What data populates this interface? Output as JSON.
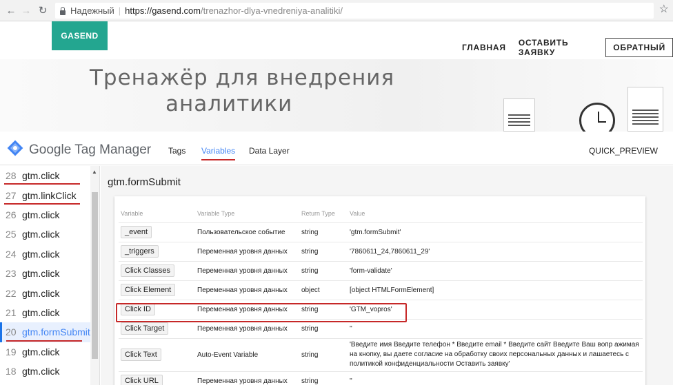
{
  "browser": {
    "secure_label": "Надежный",
    "url_host": "https://gasend.com",
    "url_path": "/trenazhor-dlya-vnedreniya-analitiki/"
  },
  "site": {
    "logo": "GASEND",
    "nav": [
      "ГЛАВНАЯ",
      "ОСТАВИТЬ ЗАЯВКУ",
      "ОБРАТНЫЙ"
    ],
    "hero_line1": "Тренажёр для внедрения",
    "hero_line2": "аналитики"
  },
  "gtm": {
    "title": "Google Tag Manager",
    "tabs": [
      "Tags",
      "Variables",
      "Data Layer"
    ],
    "active_tab": "Variables",
    "quick_preview": "QUICK_PREVIEW"
  },
  "events": [
    {
      "num": "28",
      "name": "gtm.click",
      "underlined": true
    },
    {
      "num": "27",
      "name": "gtm.linkClick",
      "underlined": true
    },
    {
      "num": "26",
      "name": "gtm.click"
    },
    {
      "num": "25",
      "name": "gtm.click"
    },
    {
      "num": "24",
      "name": "gtm.click"
    },
    {
      "num": "23",
      "name": "gtm.click"
    },
    {
      "num": "22",
      "name": "gtm.click"
    },
    {
      "num": "21",
      "name": "gtm.click"
    },
    {
      "num": "20",
      "name": "gtm.formSubmit",
      "active": true,
      "underlined": true
    },
    {
      "num": "19",
      "name": "gtm.click"
    },
    {
      "num": "18",
      "name": "gtm.click"
    }
  ],
  "detail": {
    "event_title": "gtm.formSubmit",
    "columns": [
      "Variable",
      "Variable Type",
      "Return Type",
      "Value"
    ],
    "rows": [
      {
        "variable": "_event",
        "type": "Пользовательское событие",
        "return": "string",
        "value": "'gtm.formSubmit'"
      },
      {
        "variable": "_triggers",
        "type": "Переменная уровня данных",
        "return": "string",
        "value": "'7860611_24,7860611_29'"
      },
      {
        "variable": "Click Classes",
        "type": "Переменная уровня данных",
        "return": "string",
        "value": "'form-validate'"
      },
      {
        "variable": "Click Element",
        "type": "Переменная уровня данных",
        "return": "object",
        "value": "[object HTMLFormElement]"
      },
      {
        "variable": "Click ID",
        "type": "Переменная уровня данных",
        "return": "string",
        "value": "'GTM_vopros'"
      },
      {
        "variable": "Click Target",
        "type": "Переменная уровня данных",
        "return": "string",
        "value": "''"
      },
      {
        "variable": "Click Text",
        "type": "Auto-Event Variable",
        "return": "string",
        "value": "'Введите имя Введите телефон * Введите email * Введите сайт Введите Ваш вопр ажимая на кнопку, вы даете согласие на обработку своих персональных данных и лашаетесь с политикой конфиденциальности Оставить заявку'"
      },
      {
        "variable": "Click URL",
        "type": "Переменная уровня данных",
        "return": "string",
        "value": "''"
      }
    ]
  }
}
